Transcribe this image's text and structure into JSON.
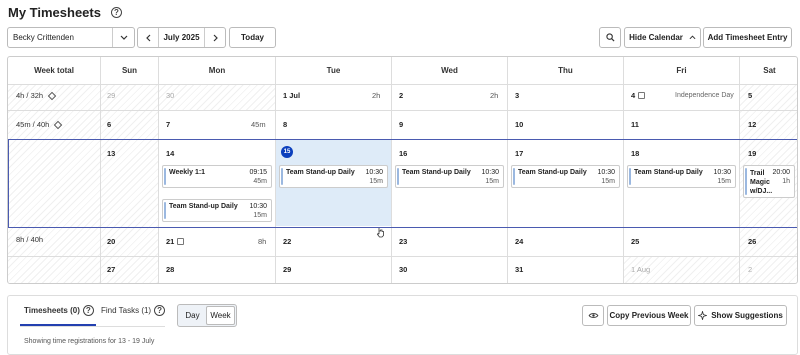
{
  "header": {
    "title": "My Timesheets",
    "help_icon": "?"
  },
  "toolbar": {
    "user": "Becky Crittenden",
    "month": "July 2025",
    "today": "Today",
    "hide_calendar": "Hide Calendar",
    "add_entry": "Add Timesheet Entry"
  },
  "columns": [
    "Week total",
    "Sun",
    "Mon",
    "Tue",
    "Wed",
    "Thu",
    "Fri",
    "Sat"
  ],
  "weeks": [
    {
      "total": "4h / 32h",
      "days": [
        "29",
        "30",
        "1 Jul",
        "2",
        "3",
        "4",
        "5"
      ],
      "hours": {
        "tue": "2h",
        "wed": "2h"
      },
      "holiday": "Independence Day"
    },
    {
      "total": "45m / 40h",
      "days": [
        "6",
        "7",
        "8",
        "9",
        "10",
        "11",
        "12"
      ],
      "hours": {
        "mon": "45m"
      }
    },
    {
      "total": "",
      "days": [
        "13",
        "14",
        "15",
        "16",
        "17",
        "18",
        "19"
      ]
    },
    {
      "total": "8h / 40h",
      "days": [
        "20",
        "21",
        "22",
        "23",
        "24",
        "25",
        "26"
      ],
      "hours": {
        "mon": "8h"
      }
    },
    {
      "total": "",
      "days": [
        "27",
        "28",
        "29",
        "30",
        "31",
        "1 Aug",
        "2"
      ]
    }
  ],
  "events": {
    "mon1": {
      "title": "Weekly 1:1",
      "time": "09:15",
      "dur": "45m"
    },
    "mon2": {
      "title": "Team Stand-up Daily",
      "time": "10:30",
      "dur": "15m"
    },
    "tue": {
      "title": "Team Stand-up Daily",
      "time": "10:30",
      "dur": "15m"
    },
    "wed": {
      "title": "Team Stand-up Daily",
      "time": "10:30",
      "dur": "15m"
    },
    "thu": {
      "title": "Team Stand-up Daily",
      "time": "10:30",
      "dur": "15m"
    },
    "fri": {
      "title": "Team Stand-up Daily",
      "time": "10:30",
      "dur": "15m"
    },
    "sat": {
      "title": "Trail Magic w/DJ...",
      "time": "20:00",
      "dur": "1h"
    }
  },
  "bottom": {
    "tab_timesheets": "Timesheets (0)",
    "tab_find": "Find Tasks (1)",
    "seg_day": "Day",
    "seg_week": "Week",
    "copy": "Copy Previous Week",
    "suggest": "Show Suggestions",
    "subtitle": "Showing time registrations for 13 - 19 July"
  },
  "colors": {
    "accent": "#0b3fbd",
    "today_bg": "#deebf8",
    "current_week_border": "#4a5ab0"
  }
}
